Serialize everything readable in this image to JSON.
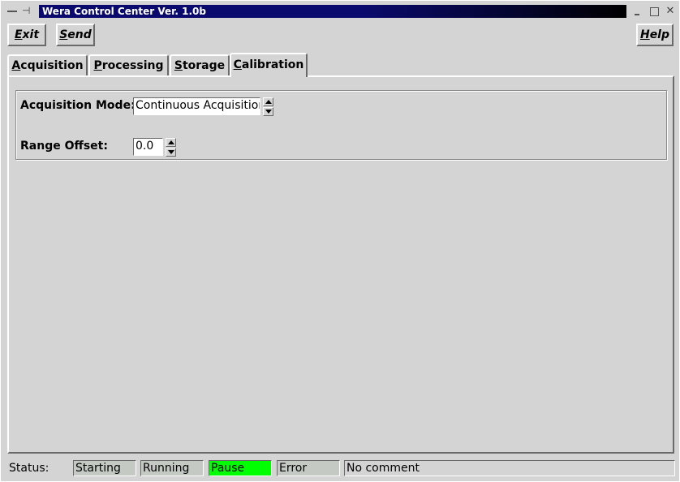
{
  "window": {
    "title": "Wera Control Center Ver. 1.0b"
  },
  "toolbar": {
    "exit_first": "E",
    "exit_rest": "xit",
    "send_first": "S",
    "send_rest": "end",
    "help_first": "H",
    "help_rest": "elp"
  },
  "tabs": [
    {
      "first": "A",
      "rest": "cquisition",
      "active": false
    },
    {
      "first": "P",
      "rest": "rocessing",
      "active": false
    },
    {
      "first": "S",
      "rest": "torage",
      "active": false
    },
    {
      "first": "C",
      "rest": "alibration",
      "active": true
    }
  ],
  "form": {
    "acquisition_mode_label": "Acquisition Mode:",
    "acquisition_mode_value": "Continuous Acquisition",
    "range_offset_label": "Range Offset:",
    "range_offset_value": "0.0"
  },
  "status": {
    "label": "Status:",
    "indicators": [
      {
        "text": "Starting",
        "color": "#c4c9c4"
      },
      {
        "text": "Running",
        "color": "#c4c9c4"
      },
      {
        "text": "Pause",
        "color": "#00ff00"
      },
      {
        "text": "Error",
        "color": "#c4c9c4"
      }
    ],
    "comment": "No comment"
  }
}
